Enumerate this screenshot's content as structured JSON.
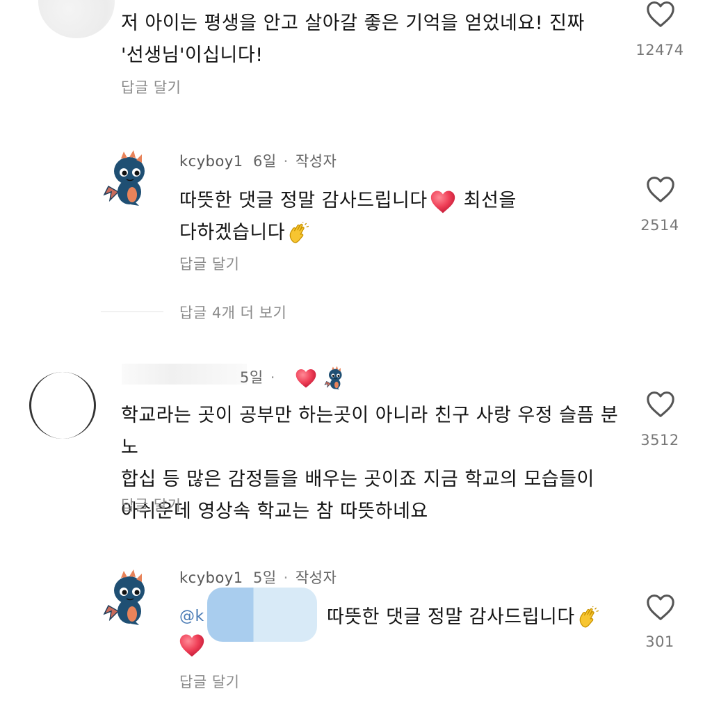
{
  "comments": [
    {
      "text_line1": "저 아이는 평생을 안고 살아갈 좋은 기억을 얻었네요! 진짜",
      "text_line2": "'선생님'이십니다!",
      "reply_label": "답글 달기",
      "likes": "12474"
    },
    {
      "author": "kcyboy1",
      "age": "6일",
      "sep": "·",
      "author_badge": "작성자",
      "text_line1": "따뜻한 댓글 정말 감사드립니다",
      "text_line1b": "최선을",
      "text_line2": "다하겠습니다",
      "reply_label": "답글 달기",
      "likes": "2514"
    },
    {
      "view_more": "답글 4개 더 보기"
    },
    {
      "age": "5일",
      "sep": "·",
      "text_line1": "학교라는 곳이 공부만 하는곳이 아니라 친구 사랑 우정 슬픔 분노",
      "text_line2": "합십 등 많은 감정들을 배우는 곳이죠 지금 학교의 모습들이",
      "text_line3": "아쉬운데 영상속 학교는 참 따뜻하네요",
      "reply_label": "답글 달기",
      "likes": "3512"
    },
    {
      "author": "kcyboy1",
      "age": "5일",
      "sep": "·",
      "author_badge": "작성자",
      "mention": "@k",
      "text_line1": "따뜻한 댓글 정말 감사드립니다",
      "reply_label": "답글 달기",
      "likes": "301"
    }
  ],
  "colors": {
    "heart_red": "#e8334a",
    "dragon_blue": "#1f4f73",
    "dragon_orange": "#e8835a",
    "clap_yellow": "#f5c518",
    "blur_blue": "#a9cdee"
  }
}
